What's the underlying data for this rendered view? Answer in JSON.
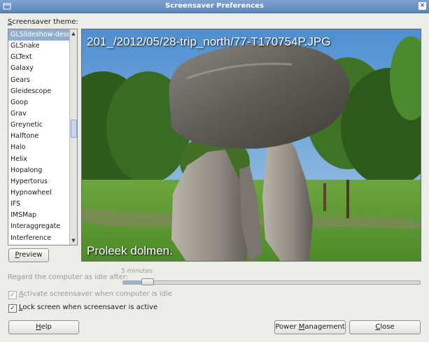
{
  "window": {
    "title": "Screensaver Preferences"
  },
  "theme": {
    "label_prefix": "S",
    "label_rest": "creensaver theme:",
    "items": [
      {
        "label": "GLSlideshow-desc",
        "selected": true
      },
      {
        "label": "GLSnake"
      },
      {
        "label": "GLText"
      },
      {
        "label": "Galaxy"
      },
      {
        "label": "Gears"
      },
      {
        "label": "Gleidescope"
      },
      {
        "label": "Goop"
      },
      {
        "label": "Grav"
      },
      {
        "label": "Greynetic"
      },
      {
        "label": "Halftone"
      },
      {
        "label": "Halo"
      },
      {
        "label": "Helix"
      },
      {
        "label": "Hopalong"
      },
      {
        "label": "Hypertorus"
      },
      {
        "label": "Hypnowheel"
      },
      {
        "label": "IFS"
      },
      {
        "label": "IMSMap"
      },
      {
        "label": "Interaggregate"
      },
      {
        "label": "Interference"
      }
    ]
  },
  "preview": {
    "filename": "201_/2012/05/28-trip_north/77-T170754P.JPG",
    "caption": "Proleek dolmen.",
    "button_prefix": "P",
    "button_rest": "review"
  },
  "idle": {
    "label": "Regard the computer as idle after:",
    "value": "5 minutes",
    "fraction": 0.04
  },
  "activate": {
    "prefix": "A",
    "rest": "ctivate screensaver when computer is idle",
    "checked": true,
    "enabled": false
  },
  "lock": {
    "prefix": "L",
    "rest": "ock screen when screensaver is active",
    "checked": true,
    "enabled": true
  },
  "buttons": {
    "help_prefix": "H",
    "help_rest": "elp",
    "power_a": "Power ",
    "power_u": "M",
    "power_b": "anagement",
    "close_prefix": "C",
    "close_rest": "lose"
  },
  "colors": {
    "selection": "#90add2",
    "titlebar": "#6f95c5"
  }
}
